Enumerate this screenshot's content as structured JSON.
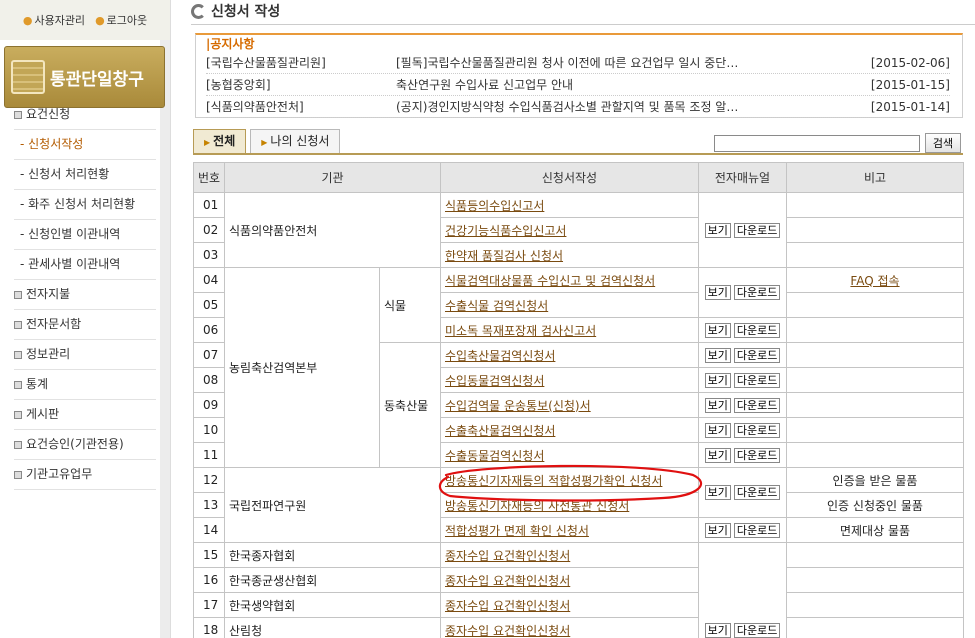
{
  "top_links": {
    "user_manage": "사용자관리",
    "logout": "로그아웃"
  },
  "sidebar": {
    "title": "통관단일창구",
    "menu": [
      {
        "label": "요건신청",
        "type": "main"
      },
      {
        "label": "- 신청서작성",
        "type": "sub",
        "active": true
      },
      {
        "label": "- 신청서 처리현황",
        "type": "sub"
      },
      {
        "label": "- 화주 신청서 처리현황",
        "type": "sub"
      },
      {
        "label": "- 신청인별 이관내역",
        "type": "sub"
      },
      {
        "label": "- 관세사별 이관내역",
        "type": "sub"
      },
      {
        "label": "전자지불",
        "type": "main"
      },
      {
        "label": "전자문서함",
        "type": "main"
      },
      {
        "label": "정보관리",
        "type": "main"
      },
      {
        "label": "통계",
        "type": "main"
      },
      {
        "label": "게시판",
        "type": "main"
      },
      {
        "label": "요건승인(기관전용)",
        "type": "main"
      },
      {
        "label": "기관고유업무",
        "type": "main"
      }
    ]
  },
  "page_title": "신청서 작성",
  "notice": {
    "title": "공지사항",
    "items": [
      {
        "org": "[국립수산물품질관리원]",
        "subject": "[필독]국립수산물품질관리원 청사 이전에 따른 요건업무 일시 중단…",
        "date": "[2015-02-06]"
      },
      {
        "org": "[농협중앙회]",
        "subject": "축산연구원 수입사료 신고업무 안내",
        "date": "[2015-01-15]"
      },
      {
        "org": "[식품의약품안전처]",
        "subject": "(공지)경인지방식약청 수입식품검사소별 관할지역 및 품목 조정 알…",
        "date": "[2015-01-14]"
      }
    ]
  },
  "tabs": [
    {
      "label": "전체",
      "active": true
    },
    {
      "label": "나의 신청서",
      "active": false
    }
  ],
  "search": {
    "value": "",
    "button": "검색"
  },
  "table": {
    "headers": {
      "no": "번호",
      "org": "기관",
      "form": "신청서작성",
      "manual": "전자매뉴얼",
      "remark": "비고"
    },
    "buttons": {
      "view": "보기",
      "download": "다운로드"
    },
    "orgs": {
      "mfds": "식품의약품안전처",
      "qia": "농림축산검역본부",
      "plant": "식물",
      "animal": "동축산물",
      "rra": "국립전파연구원",
      "seed": "한국종자협회",
      "fungi": "한국종균생산협회",
      "bio": "한국생약협회",
      "forest": "산림청"
    },
    "rows": [
      {
        "no": "01",
        "form": "식품등의수입신고서",
        "remark": ""
      },
      {
        "no": "02",
        "form": "건강기능식품수입신고서",
        "remark": ""
      },
      {
        "no": "03",
        "form": "한약재 품질검사 신청서",
        "remark": ""
      },
      {
        "no": "04",
        "form": "식물검역대상물품 수입신고 및 검역신청서",
        "remark": "FAQ 접속"
      },
      {
        "no": "05",
        "form": "수출식물 검역신청서",
        "remark": ""
      },
      {
        "no": "06",
        "form": "미소독 목재포장재 검사신고서",
        "remark": ""
      },
      {
        "no": "07",
        "form": "수입축산물검역신청서",
        "remark": ""
      },
      {
        "no": "08",
        "form": "수입동물검역신청서",
        "remark": ""
      },
      {
        "no": "09",
        "form": "수입검역물 운송통보(신청)서",
        "remark": ""
      },
      {
        "no": "10",
        "form": "수출축산물검역신청서",
        "remark": ""
      },
      {
        "no": "11",
        "form": "수출동물검역신청서",
        "remark": ""
      },
      {
        "no": "12",
        "form": "방송통신기자재등의 적합성평가확인 신청서",
        "remark": "인증을 받은 물품"
      },
      {
        "no": "13",
        "form": "방송통신기자재등의 사전통관 신청서",
        "remark": "인증 신청중인 물품"
      },
      {
        "no": "14",
        "form": "적합성평가 면제 확인 신청서",
        "remark": "면제대상 물품"
      },
      {
        "no": "15",
        "form": "종자수입 요건확인신청서",
        "remark": ""
      },
      {
        "no": "16",
        "form": "종자수입 요건확인신청서",
        "remark": ""
      },
      {
        "no": "17",
        "form": "종자수입 요건확인신청서",
        "remark": ""
      },
      {
        "no": "18",
        "form": "종자수입 요건확인신청서",
        "remark": ""
      }
    ]
  },
  "annotation_color": "#e01010"
}
